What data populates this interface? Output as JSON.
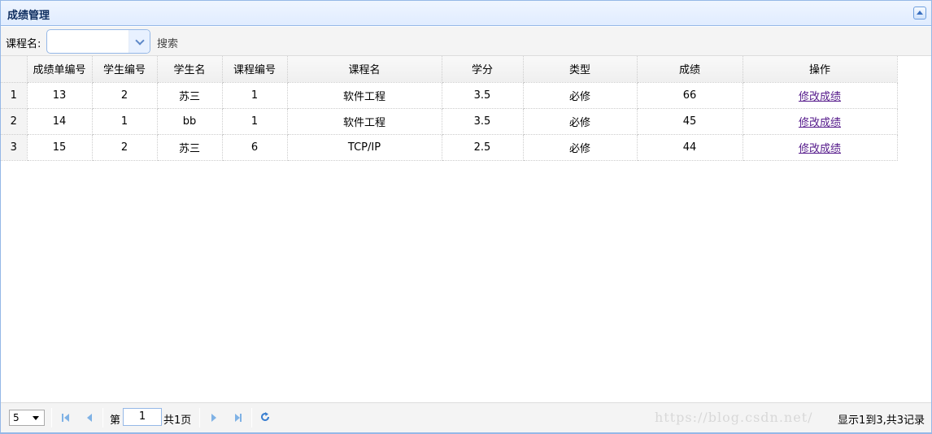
{
  "panel": {
    "title": "成绩管理"
  },
  "toolbar": {
    "course_label": "课程名:",
    "course_value": "",
    "search_label": "搜索"
  },
  "grid": {
    "columns": [
      "成绩单编号",
      "学生编号",
      "学生名",
      "课程编号",
      "课程名",
      "学分",
      "类型",
      "成绩",
      "操作"
    ],
    "rows": [
      {
        "num": "1",
        "score_id": "13",
        "student_id": "2",
        "student_name": "苏三",
        "course_id": "1",
        "course_name": "软件工程",
        "credit": "3.5",
        "type": "必修",
        "score": "66",
        "action": "修改成绩"
      },
      {
        "num": "2",
        "score_id": "14",
        "student_id": "1",
        "student_name": "bb",
        "course_id": "1",
        "course_name": "软件工程",
        "credit": "3.5",
        "type": "必修",
        "score": "45",
        "action": "修改成绩"
      },
      {
        "num": "3",
        "score_id": "15",
        "student_id": "2",
        "student_name": "苏三",
        "course_id": "6",
        "course_name": "TCP/IP",
        "credit": "2.5",
        "type": "必修",
        "score": "44",
        "action": "修改成绩"
      }
    ]
  },
  "pager": {
    "page_size": "5",
    "page_prefix": "第",
    "current_page": "1",
    "total_pages": "共1页",
    "info": "显示1到3,共3记录",
    "watermark": "https://blog.csdn.net/"
  },
  "colors": {
    "border": "#95b8e7",
    "link": "#551a8b",
    "icon": "#7fb2e5"
  }
}
